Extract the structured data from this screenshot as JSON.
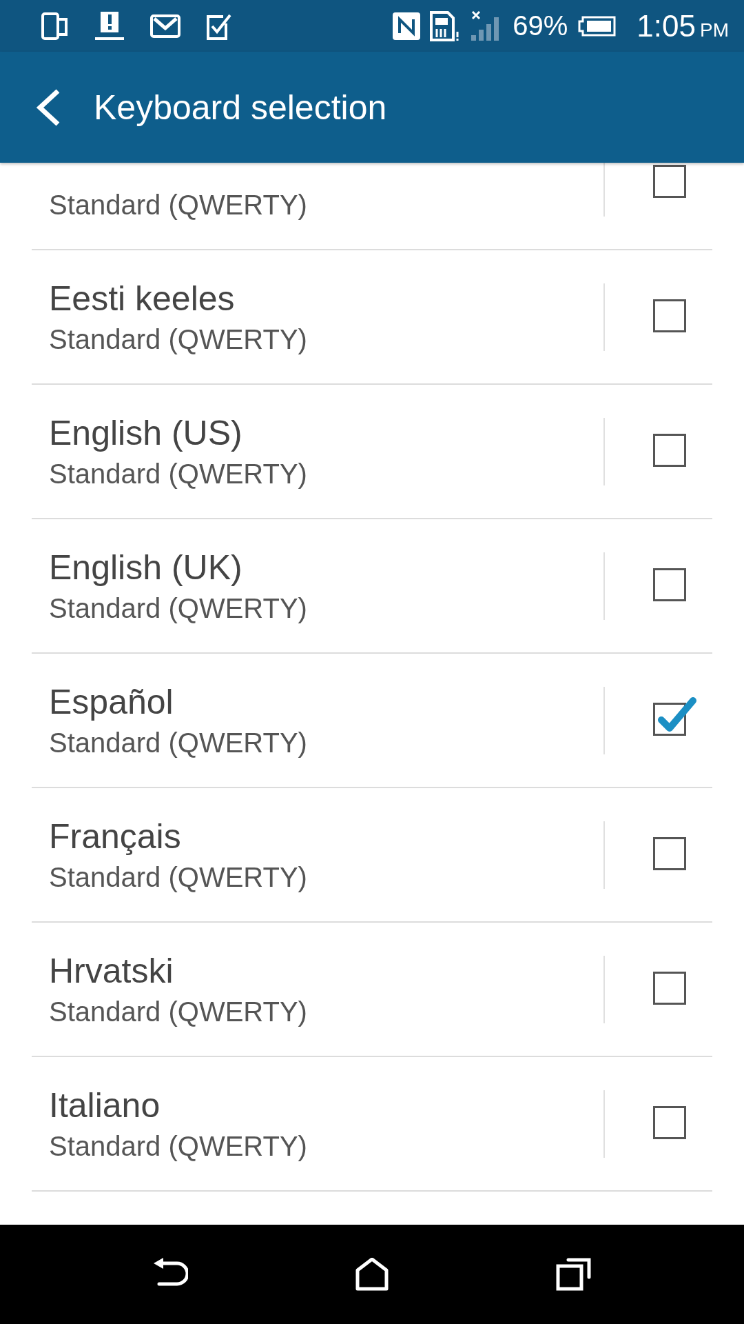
{
  "status_bar": {
    "battery_percent": "69%",
    "time": "1:05",
    "meridiem": "PM"
  },
  "app_bar": {
    "title": "Keyboard selection"
  },
  "keyboards": [
    {
      "layout": "Standard (QWERTY)",
      "checked": false
    },
    {
      "name": "Eesti keeles",
      "layout": "Standard (QWERTY)",
      "checked": false
    },
    {
      "name": "English (US)",
      "layout": "Standard (QWERTY)",
      "checked": false
    },
    {
      "name": "English (UK)",
      "layout": "Standard (QWERTY)",
      "checked": false
    },
    {
      "name": "Español",
      "layout": "Standard (QWERTY)",
      "checked": true
    },
    {
      "name": "Français",
      "layout": "Standard (QWERTY)",
      "checked": false
    },
    {
      "name": "Hrvatski",
      "layout": "Standard (QWERTY)",
      "checked": false
    },
    {
      "name": "Italiano",
      "layout": "Standard (QWERTY)",
      "checked": false
    }
  ]
}
